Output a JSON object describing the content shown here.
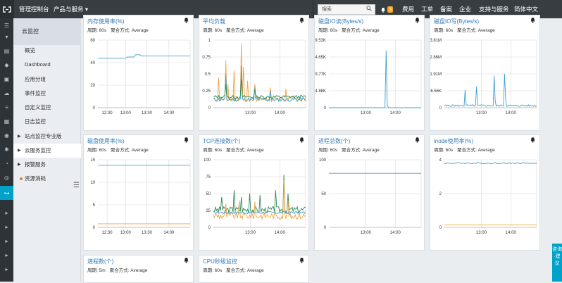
{
  "topbar": {
    "console": "管理控制台",
    "products": "产品与服务",
    "search_placeholder": "搜索",
    "badge": "3",
    "links": [
      "费用",
      "工单",
      "备案",
      "企业",
      "支持与服务",
      "简体中文"
    ]
  },
  "subnav": {
    "title": "云监控",
    "items": [
      "概览",
      "Dashboard",
      "应用分组",
      "事件监控",
      "自定义监控",
      "日志监控",
      "站点监控专业版",
      "云服务监控",
      "报警服务",
      "资源消耗"
    ]
  },
  "consult": "咨询·建议",
  "colors": {
    "blue": "#3ea0d0",
    "orange": "#f0a33c",
    "green": "#2e8b57",
    "accent": "#00a2ca"
  },
  "cards": [
    {
      "title": "内存使用率(%)",
      "period": "周期: 60s",
      "agg": "聚合方式: Average",
      "yticks": [
        "60",
        "40",
        "20",
        "0"
      ],
      "xticks": [
        "12:30",
        "13:00",
        "13:30",
        "14:00"
      ]
    },
    {
      "title": "平均负载",
      "period": "周期: 60s",
      "agg": "聚合方式: Average",
      "yticks": [
        "1",
        "0.75",
        "0.5",
        "0.25",
        "0"
      ],
      "xticks": [
        "13:00",
        "14:00"
      ]
    },
    {
      "title": "磁盘IO读(Bytes/s)",
      "period": "周期: 60s",
      "agg": "聚合方式: Average",
      "yticks": [
        "19.53K",
        "14.65K",
        "9.77K",
        "4.88K",
        "0"
      ],
      "xticks": [
        "13:00",
        "14:00"
      ]
    },
    {
      "title": "磁盘IO写(Bytes/s)",
      "period": "周期: 60s",
      "agg": "聚合方式: Average",
      "yticks": [
        "3.81M",
        "2.86M",
        "1.91M",
        "976.56K",
        "0"
      ],
      "xticks": [
        "13:00",
        "14:00"
      ]
    },
    {
      "title": "磁盘使用率(%)",
      "period": "周期: 60s",
      "agg": "聚合方式: Average",
      "yticks": [
        "15",
        "10",
        "5",
        "0"
      ],
      "xticks": [
        "12:30",
        "13:00",
        "13:30",
        "14:00"
      ]
    },
    {
      "title": "TCP连接数(个)",
      "period": "周期: 60s",
      "agg": "聚合方式: Average",
      "yticks": [
        "100",
        "75",
        "50",
        "25",
        "0"
      ],
      "xticks": [
        "13:00",
        "14:00"
      ]
    },
    {
      "title": "进程总数(个)",
      "period": "周期: 60s",
      "agg": "聚合方式: Average",
      "yticks": [
        "100",
        "50",
        "0"
      ],
      "xticks": [
        "13:00",
        "14:00"
      ]
    },
    {
      "title": "inode使用率(%)",
      "period": "周期: 60s",
      "agg": "聚合方式: Average",
      "yticks": [
        "4",
        "2",
        "0"
      ],
      "xticks": [
        "13:00",
        "14:00"
      ]
    },
    {
      "title": "进程数(个)",
      "period": "周期: 5m",
      "agg": "聚合方式: Average",
      "yticks": [],
      "xticks": []
    },
    {
      "title": "CPU秒级监控",
      "period": "周期: 60s",
      "agg": "聚合方式: Average",
      "yticks": [],
      "xticks": []
    }
  ]
}
